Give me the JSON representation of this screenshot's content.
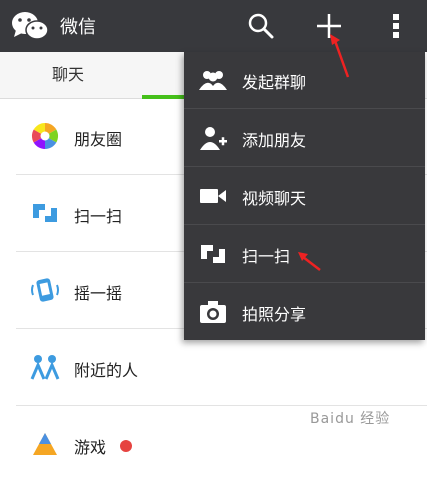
{
  "header": {
    "app_title": "微信",
    "icons": [
      "wechat-logo",
      "search-icon",
      "plus-icon",
      "more-vert-icon"
    ],
    "bg_color": "#38393d"
  },
  "tabs": [
    {
      "label": "聊天"
    }
  ],
  "accent_color": "#45c01a",
  "discover_list": [
    {
      "label": "朋友圈",
      "icon": "moments-icon"
    },
    {
      "label": "扫一扫",
      "icon": "scan-icon"
    },
    {
      "label": "摇一摇",
      "icon": "shake-icon"
    },
    {
      "label": "附近的人",
      "icon": "people-nearby-icon"
    },
    {
      "label": "游戏",
      "icon": "games-icon",
      "badge": true
    }
  ],
  "menu": {
    "items": [
      {
        "label": "发起群聊",
        "icon": "group-chat-icon"
      },
      {
        "label": "添加朋友",
        "icon": "add-friend-icon"
      },
      {
        "label": "视频聊天",
        "icon": "video-chat-icon"
      },
      {
        "label": "扫一扫",
        "icon": "scan-icon"
      },
      {
        "label": "拍照分享",
        "icon": "camera-icon"
      }
    ],
    "bg_color": "#39393c"
  },
  "watermark": {
    "text": "Baidu 经验"
  }
}
